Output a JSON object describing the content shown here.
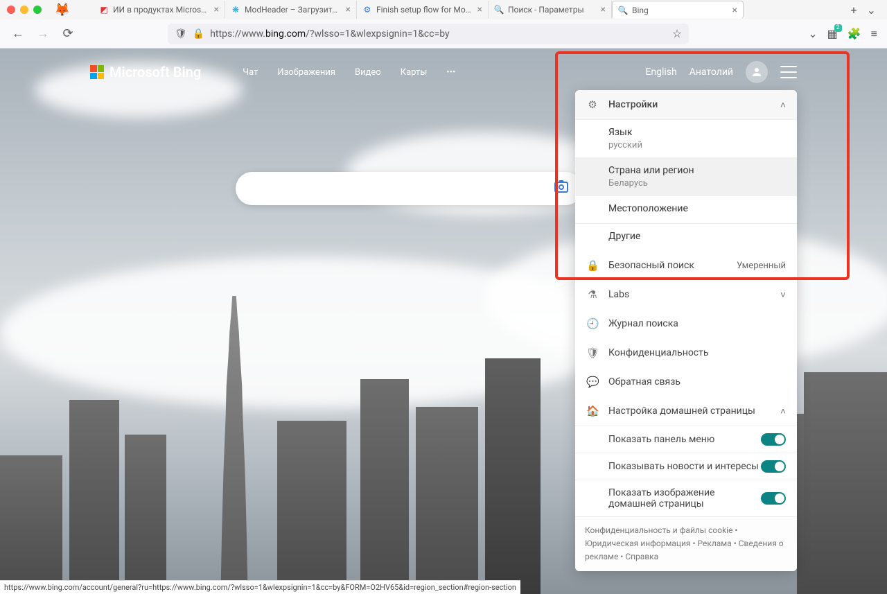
{
  "tabs": [
    {
      "title": "ИИ в продуктах Microsoft:",
      "favicon": "🟥"
    },
    {
      "title": "ModHeader – Загрузите эт",
      "favicon": "✳"
    },
    {
      "title": "Finish setup flow for ModH",
      "favicon": "⚙"
    },
    {
      "title": "Поиск - Параметры",
      "favicon": "🔍"
    },
    {
      "title": "Bing",
      "favicon": "🔍",
      "active": true
    }
  ],
  "url": {
    "prefix": "https://www.",
    "domain": "bing.com",
    "suffix": "/?wlsso=1&wlexpsignin=1&cc=by"
  },
  "ext_badge": "2",
  "bing": {
    "logo_text": "Microsoft Bing",
    "nav": {
      "chat": "Чат",
      "images": "Изображения",
      "video": "Видео",
      "maps": "Карты",
      "more": "•••"
    },
    "header_right": {
      "lang": "English",
      "user": "Анатолий"
    }
  },
  "settings": {
    "header": "Настройки",
    "language": {
      "label": "Язык",
      "value": "русский"
    },
    "region": {
      "label": "Страна или регион",
      "value": "Беларусь"
    },
    "location": "Местоположение",
    "others": "Другие",
    "safesearch": {
      "label": "Безопасный поиск",
      "value": "Умеренный"
    },
    "labs": "Labs",
    "history": "Журнал поиска",
    "privacy": "Конфиденциальность",
    "feedback": "Обратная связь",
    "homepage": "Настройка домашней страницы",
    "toggle1": "Показать панель меню",
    "toggle2": "Показывать новости и интересы",
    "toggle3": "Показать изображение домашней страницы",
    "footer": "Конфиденциальность и файлы cookie • Юридическая информация • Реклама • Сведения о рекламе • Справка"
  },
  "status_bar": "https://www.bing.com/account/general?ru=https://www.bing.com/?wlsso=1&wlexpsignin=1&cc=by&FORM=O2HV65&id=region_section#region-section"
}
